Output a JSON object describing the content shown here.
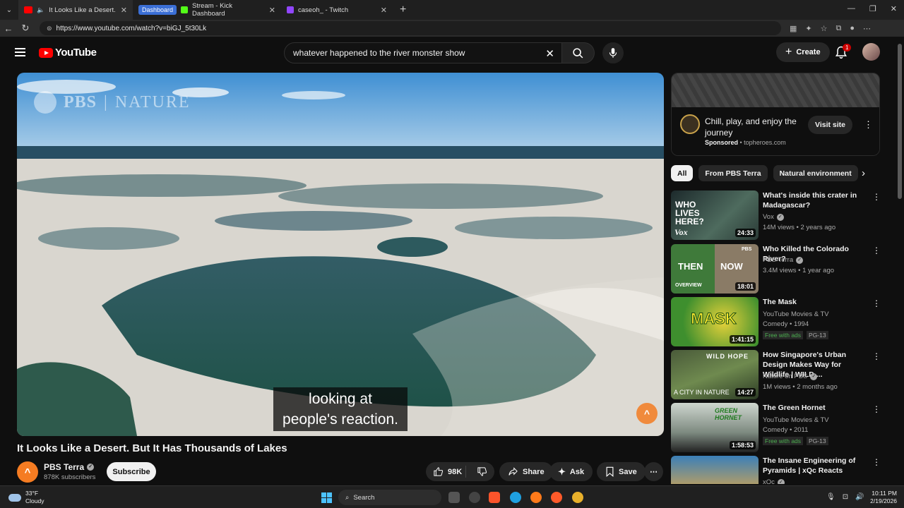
{
  "browser": {
    "tabs": [
      {
        "label": "It Looks Like a Desert. But It H",
        "active": true
      },
      {
        "group_label": "Dashboard",
        "label": "Stream - Kick Dashboard"
      },
      {
        "label": "caseoh_ - Twitch"
      }
    ],
    "url": "https://www.youtube.com/watch?v=biGJ_5t30Lk"
  },
  "header": {
    "logo_text": "YouTube",
    "search_value": "whatever happened to the river monster show",
    "create_label": "Create",
    "notification_count": "1"
  },
  "player": {
    "watermark_brand": "PBS",
    "watermark_separator": "|",
    "watermark_show": "NATURE",
    "caption_line1": "looking at",
    "caption_line2": "people's reaction.",
    "corner_badge": "^"
  },
  "video": {
    "title": "It Looks Like a Desert. But It Has Thousands of Lakes",
    "channel": "PBS Terra",
    "channel_initial": "^",
    "subscribers": "878K subscribers",
    "subscribe_label": "Subscribe",
    "likes": "98K",
    "share_label": "Share",
    "ask_label": "Ask",
    "save_label": "Save"
  },
  "ad": {
    "title": "Chill, play, and enjoy the journey",
    "sponsored": "Sponsored",
    "domain": "topheroes.com",
    "visit_label": "Visit site"
  },
  "chips": [
    "All",
    "From PBS Terra",
    "Natural environment"
  ],
  "recommendations": [
    {
      "title": "What's inside this crater in Madagascar?",
      "channel": "Vox",
      "verified": true,
      "meta": "14M views • 2 years ago",
      "duration": "24:33",
      "thumb_text": "WHO LIVES HERE?",
      "thumb_logo": "Vox"
    },
    {
      "title": "Who Killed the Colorado River?",
      "channel": "PBS Terra",
      "verified": true,
      "meta": "3.4M views • 1 year ago",
      "duration": "18:01",
      "thumb_text_left": "THEN",
      "thumb_text_right": "NOW",
      "thumb_logo": "OVERVIEW",
      "thumb_corner": "PBS"
    },
    {
      "title": "The Mask",
      "channel": "YouTube Movies & TV",
      "verified": false,
      "meta": "Comedy • 1994",
      "badge_free": "Free with ads",
      "badge_rating": "PG-13",
      "duration": "1:41:15",
      "thumb_text": "MASK"
    },
    {
      "title": "How Singapore's Urban Design Makes Way for Wildlife | WILD ...",
      "channel": "Nature on PBS",
      "verified": true,
      "meta": "1M views • 2 months ago",
      "duration": "14:27",
      "thumb_text": "A CITY IN NATURE",
      "thumb_top": "WILD HOPE"
    },
    {
      "title": "The Green Hornet",
      "channel": "YouTube Movies & TV",
      "verified": false,
      "meta": "Comedy • 2011",
      "badge_free": "Free with ads",
      "badge_rating": "PG-13",
      "duration": "1:58:53",
      "thumb_text": "GREEN HORNET"
    },
    {
      "title": "The Insane Engineering of Pyramids | xQc Reacts",
      "channel": "xQc",
      "verified": true
    }
  ],
  "taskbar": {
    "temperature": "33°F",
    "condition": "Cloudy",
    "search_label": "Search",
    "time": "10:11 PM",
    "date": "2/19/2026"
  },
  "colors": {
    "background": "#0f0f0f",
    "brand_red": "#ff0000",
    "accent_blue": "#3b6fd6",
    "free_green": "#4caf50"
  }
}
